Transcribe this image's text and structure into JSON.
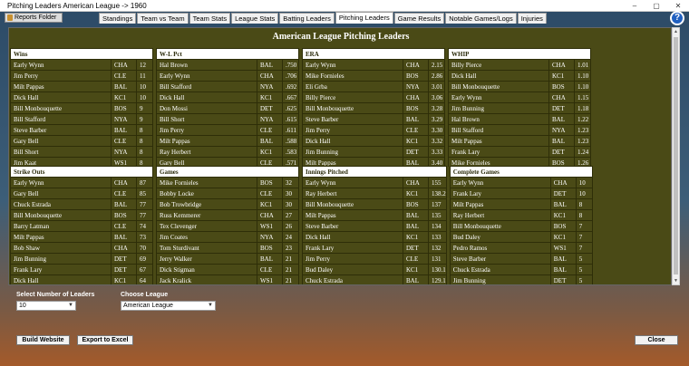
{
  "window": {
    "title": "Pitching Leaders American League -> 1960",
    "controls": [
      "–",
      "▢",
      "✕"
    ]
  },
  "reports_button": "Reports Folder",
  "tabs": [
    "Standings",
    "Team vs Team",
    "Team Stats",
    "League Stats",
    "Batting Leaders",
    "Pitching Leaders",
    "Game Results",
    "Notable Games/Logs",
    "Injuries"
  ],
  "active_tab": 5,
  "help_icon": "?",
  "report": {
    "title": "American League Pitching Leaders",
    "sections": [
      [
        {
          "header": "Wins",
          "rows": [
            [
              "Early Wynn",
              "CHA",
              "12"
            ],
            [
              "Jim Perry",
              "CLE",
              "11"
            ],
            [
              "Milt Pappas",
              "BAL",
              "10"
            ],
            [
              "Dick Hall",
              "KC1",
              "10"
            ],
            [
              "Bill Monbouquette",
              "BOS",
              "9"
            ],
            [
              "Bill Stafford",
              "NYA",
              "9"
            ],
            [
              "Steve Barber",
              "BAL",
              "8"
            ],
            [
              "Gary Bell",
              "CLE",
              "8"
            ],
            [
              "Bill Short",
              "NYA",
              "8"
            ],
            [
              "Jim Kaat",
              "WS1",
              "8"
            ]
          ]
        },
        {
          "header": "W-L Pct",
          "rows": [
            [
              "Hal Brown",
              "BAL",
              ".750"
            ],
            [
              "Early Wynn",
              "CHA",
              ".706"
            ],
            [
              "Bill Stafford",
              "NYA",
              ".692"
            ],
            [
              "Dick Hall",
              "KC1",
              ".667"
            ],
            [
              "Don Mossi",
              "DET",
              ".625"
            ],
            [
              "Bill Short",
              "NYA",
              ".615"
            ],
            [
              "Jim Perry",
              "CLE",
              ".611"
            ],
            [
              "Milt Pappas",
              "BAL",
              ".588"
            ],
            [
              "Ray Herbert",
              "KC1",
              ".583"
            ],
            [
              "Gary Bell",
              "CLE",
              ".571"
            ]
          ]
        },
        {
          "header": "ERA",
          "rows": [
            [
              "Early Wynn",
              "CHA",
              "2.15"
            ],
            [
              "Mike Fornieles",
              "BOS",
              "2.86"
            ],
            [
              "Eli Grba",
              "NYA",
              "3.01"
            ],
            [
              "Billy Pierce",
              "CHA",
              "3.06"
            ],
            [
              "Bill Monbouquette",
              "BOS",
              "3.28"
            ],
            [
              "Steve Barber",
              "BAL",
              "3.29"
            ],
            [
              "Jim Perry",
              "CLE",
              "3.30"
            ],
            [
              "Dick Hall",
              "KC1",
              "3.32"
            ],
            [
              "Jim Bunning",
              "DET",
              "3.33"
            ],
            [
              "Milt Pappas",
              "BAL",
              "3.40"
            ]
          ]
        },
        {
          "header": "WHIP",
          "rows": [
            [
              "Billy Pierce",
              "CHA",
              "1.01"
            ],
            [
              "Dick Hall",
              "KC1",
              "1.10"
            ],
            [
              "Bill Monbouquette",
              "BOS",
              "1.10"
            ],
            [
              "Early Wynn",
              "CHA",
              "1.15"
            ],
            [
              "Jim Bunning",
              "DET",
              "1.18"
            ],
            [
              "Hal Brown",
              "BAL",
              "1.22"
            ],
            [
              "Bill Stafford",
              "NYA",
              "1.23"
            ],
            [
              "Milt Pappas",
              "BAL",
              "1.23"
            ],
            [
              "Frank Lary",
              "DET",
              "1.24"
            ],
            [
              "Mike Fornieles",
              "BOS",
              "1.26"
            ]
          ]
        }
      ],
      [
        {
          "header": "Strike Outs",
          "rows": [
            [
              "Early Wynn",
              "CHA",
              "87"
            ],
            [
              "Gary Bell",
              "CLE",
              "85"
            ],
            [
              "Chuck Estrada",
              "BAL",
              "77"
            ],
            [
              "Bill Monbouquette",
              "BOS",
              "77"
            ],
            [
              "Barry Latman",
              "CLE",
              "74"
            ],
            [
              "Milt Pappas",
              "BAL",
              "73"
            ],
            [
              "Bob Shaw",
              "CHA",
              "70"
            ],
            [
              "Jim Bunning",
              "DET",
              "69"
            ],
            [
              "Frank Lary",
              "DET",
              "67"
            ],
            [
              "Dick Hall",
              "KC1",
              "64"
            ]
          ]
        },
        {
          "header": "Games",
          "rows": [
            [
              "Mike Fornieles",
              "BOS",
              "32"
            ],
            [
              "Bobby Locke",
              "CLE",
              "30"
            ],
            [
              "Bob Trowbridge",
              "KC1",
              "30"
            ],
            [
              "Russ Kemmerer",
              "CHA",
              "27"
            ],
            [
              "Tex Clevenger",
              "WS1",
              "26"
            ],
            [
              "Jim Coates",
              "NYA",
              "24"
            ],
            [
              "Tom Sturdivant",
              "BOS",
              "23"
            ],
            [
              "Jerry Walker",
              "BAL",
              "21"
            ],
            [
              "Dick Stigman",
              "CLE",
              "21"
            ],
            [
              "Jack Kralick",
              "WS1",
              "21"
            ]
          ]
        },
        {
          "header": "Innings Pitched",
          "rows": [
            [
              "Early Wynn",
              "CHA",
              "155"
            ],
            [
              "Ray Herbert",
              "KC1",
              "138.2"
            ],
            [
              "Bill Monbouquette",
              "BOS",
              "137"
            ],
            [
              "Milt Pappas",
              "BAL",
              "135"
            ],
            [
              "Steve Barber",
              "BAL",
              "134"
            ],
            [
              "Dick Hall",
              "KC1",
              "133"
            ],
            [
              "Frank Lary",
              "DET",
              "132"
            ],
            [
              "Jim Perry",
              "CLE",
              "131"
            ],
            [
              "Bud Daley",
              "KC1",
              "130.1"
            ],
            [
              "Chuck Estrada",
              "BAL",
              "129.1"
            ]
          ]
        },
        {
          "header": "Complete Games",
          "rows": [
            [
              "Early Wynn",
              "CHA",
              "10"
            ],
            [
              "Frank Lary",
              "DET",
              "10"
            ],
            [
              "Milt Pappas",
              "BAL",
              "8"
            ],
            [
              "Ray Herbert",
              "KC1",
              "8"
            ],
            [
              "Bill Monbouquette",
              "BOS",
              "7"
            ],
            [
              "Bud Daley",
              "KC1",
              "7"
            ],
            [
              "Pedro Ramos",
              "WS1",
              "7"
            ],
            [
              "Steve Barber",
              "BAL",
              "5"
            ],
            [
              "Chuck Estrada",
              "BAL",
              "5"
            ],
            [
              "Jim Bunning",
              "DET",
              "5"
            ]
          ]
        }
      ]
    ]
  },
  "controls": {
    "leaders_label": "Select Number of Leaders",
    "leaders_value": "10",
    "league_label": "Choose League",
    "league_value": "American League",
    "build_website": "Build Website",
    "export_excel": "Export to Excel",
    "close": "Close"
  }
}
